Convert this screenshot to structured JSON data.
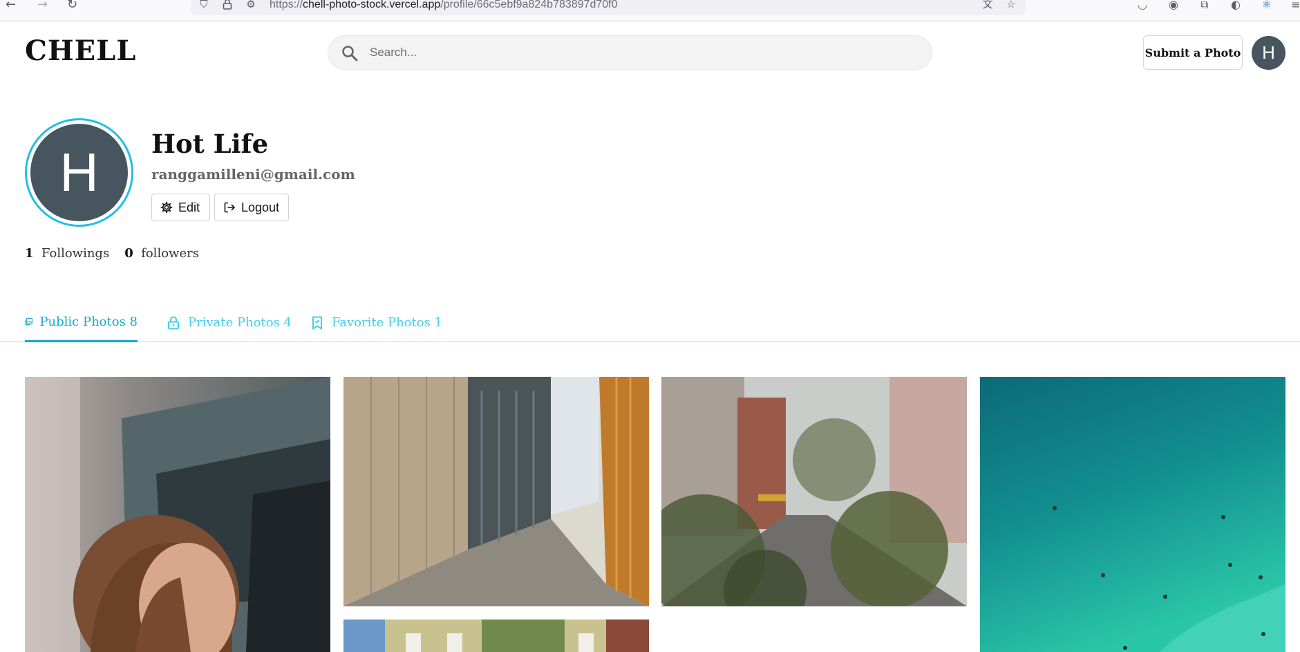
{
  "browser": {
    "url_prefix": "https://",
    "url_host": "chell-photo-stock.vercel.app",
    "url_path": "/profile/66c5ebf9a824b783897d70f0"
  },
  "header": {
    "logo": "CHELL",
    "search_placeholder": "Search...",
    "submit_label": "Submit a Photo",
    "avatar_initial": "H"
  },
  "profile": {
    "avatar_initial": "H",
    "name": "Hot Life",
    "email": "ranggamilleni@gmail.com",
    "edit_label": "Edit",
    "logout_label": "Logout",
    "followings_count": "1",
    "followings_label": "Followings",
    "followers_count": "0",
    "followers_label": "followers"
  },
  "tabs": [
    {
      "label": "Public Photos 8",
      "icon": "gallery-icon",
      "active": true
    },
    {
      "label": "Private Photos 4",
      "icon": "lock-icon",
      "active": false
    },
    {
      "label": "Favorite Photos 1",
      "icon": "bookmark-icon",
      "active": false
    }
  ],
  "photos": [
    {
      "subject": "woman-by-bus",
      "dominant_color": "#8f8a86"
    },
    {
      "subject": "building-alley",
      "dominant_color": "#a9886a"
    },
    {
      "subject": "tree-lined-street",
      "dominant_color": "#6f6e63"
    },
    {
      "subject": "turquoise-sea-swimmers",
      "dominant_color": "#1aa79b"
    },
    {
      "subject": "building-facade",
      "dominant_color": "#c8c08a"
    }
  ],
  "colors": {
    "accent": "#0da8d4",
    "accent_light": "#3fcfee",
    "avatar_bg": "#47555f"
  }
}
